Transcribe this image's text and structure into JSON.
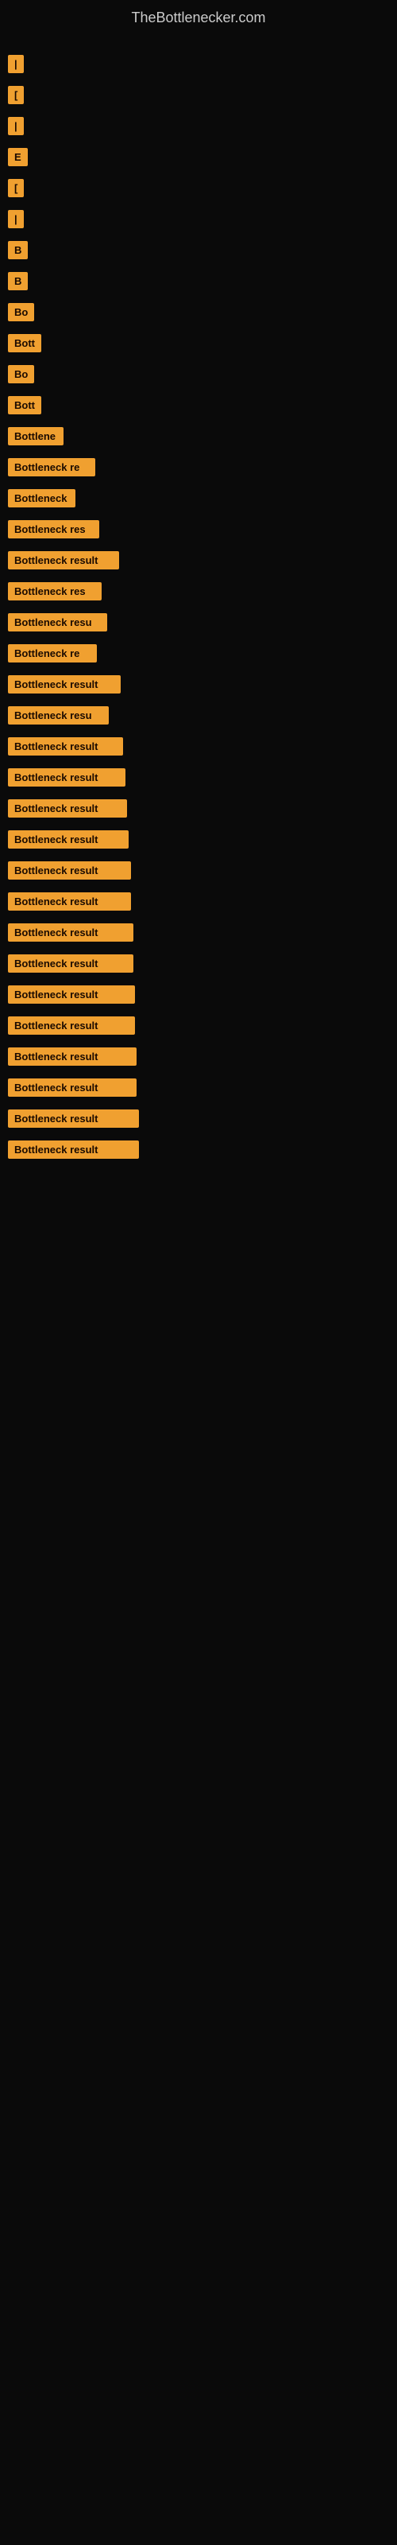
{
  "site": {
    "title": "TheBottlenecker.com"
  },
  "items": [
    {
      "label": "|",
      "width": 8
    },
    {
      "label": "[",
      "width": 10
    },
    {
      "label": "|",
      "width": 10
    },
    {
      "label": "E",
      "width": 12
    },
    {
      "label": "[",
      "width": 12
    },
    {
      "label": "|",
      "width": 12
    },
    {
      "label": "B",
      "width": 14
    },
    {
      "label": "B",
      "width": 18
    },
    {
      "label": "Bo",
      "width": 22
    },
    {
      "label": "Bott",
      "width": 30
    },
    {
      "label": "Bo",
      "width": 24
    },
    {
      "label": "Bott",
      "width": 32
    },
    {
      "label": "Bottlene",
      "width": 70
    },
    {
      "label": "Bottleneck re",
      "width": 110
    },
    {
      "label": "Bottleneck",
      "width": 85
    },
    {
      "label": "Bottleneck res",
      "width": 115
    },
    {
      "label": "Bottleneck result",
      "width": 140
    },
    {
      "label": "Bottleneck res",
      "width": 118
    },
    {
      "label": "Bottleneck resu",
      "width": 125
    },
    {
      "label": "Bottleneck re",
      "width": 112
    },
    {
      "label": "Bottleneck result",
      "width": 142
    },
    {
      "label": "Bottleneck resu",
      "width": 127
    },
    {
      "label": "Bottleneck result",
      "width": 145
    },
    {
      "label": "Bottleneck result",
      "width": 148
    },
    {
      "label": "Bottleneck result",
      "width": 150
    },
    {
      "label": "Bottleneck result",
      "width": 152
    },
    {
      "label": "Bottleneck result",
      "width": 155
    },
    {
      "label": "Bottleneck result",
      "width": 155
    },
    {
      "label": "Bottleneck result",
      "width": 158
    },
    {
      "label": "Bottleneck result",
      "width": 158
    },
    {
      "label": "Bottleneck result",
      "width": 160
    },
    {
      "label": "Bottleneck result",
      "width": 160
    },
    {
      "label": "Bottleneck result",
      "width": 162
    },
    {
      "label": "Bottleneck result",
      "width": 162
    },
    {
      "label": "Bottleneck result",
      "width": 165
    },
    {
      "label": "Bottleneck result",
      "width": 165
    }
  ]
}
